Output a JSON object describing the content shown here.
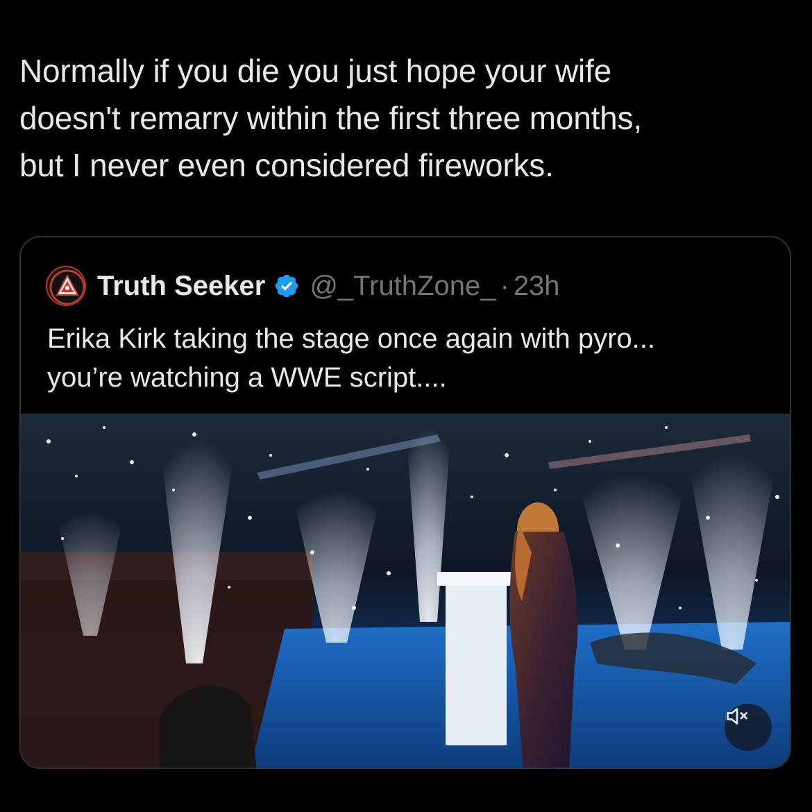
{
  "tweet": {
    "text_lines": [
      "Normally if you die you just hope your wife",
      "doesn't remarry within the first three months,",
      "but I never even considered fireworks."
    ]
  },
  "quoted_tweet": {
    "avatar_icon": "truth-zone-logo-icon",
    "display_name": "Truth Seeker",
    "verified_icon": "verified-badge-icon",
    "handle": "@_TruthZone_",
    "separator": "·",
    "time": "23h",
    "text_lines": [
      "Erika Kirk taking the stage once again with pyro...",
      "you’re watching a WWE script...."
    ],
    "media": {
      "type": "video",
      "mute_icon": "speaker-muted-icon"
    }
  },
  "colors": {
    "background": "#000000",
    "text_primary": "#e7e9ea",
    "text_secondary": "#71767b",
    "card_border": "#2f3336",
    "verified_blue": "#1d9bf0"
  }
}
